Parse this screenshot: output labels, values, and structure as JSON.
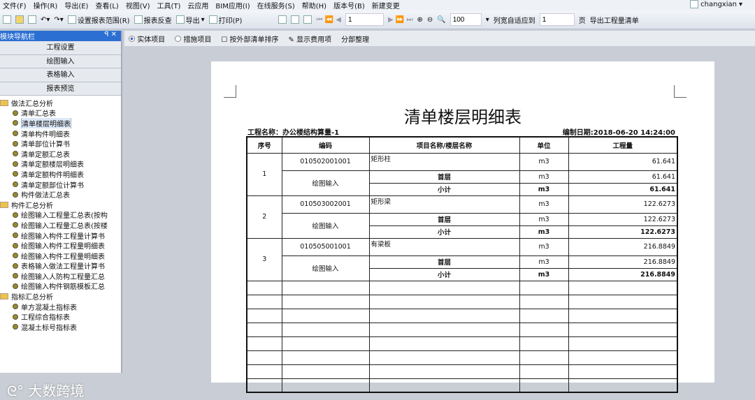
{
  "menu": [
    "文件(F)",
    "操作(R)",
    "导出(E)",
    "查看(L)",
    "视图(V)",
    "工具(T)",
    "云应用",
    "BIM应用(I)",
    "在线服务(S)",
    "帮助(H)",
    "版本号(B)",
    "新建变更"
  ],
  "user": "changxian",
  "toolbar": {
    "set_range": "设置报表范围(R)",
    "report_check": "报表反查",
    "export": "导出",
    "print": "打印(P)",
    "page": "1",
    "zoom": "100",
    "fit_label": "列宽自适应到",
    "fit_pages": "1",
    "page_unit": "页",
    "export_list": "导出工程量清单"
  },
  "nav": {
    "title": "模块导航栏",
    "buttons": [
      "工程设置",
      "绘图输入",
      "表格输入",
      "报表预览"
    ],
    "groups": [
      {
        "label": "做法汇总分析",
        "items": [
          "清单汇总表",
          "清单楼层明细表",
          "清单构件明细表",
          "清单部位计算书",
          "清单定额汇总表",
          "清单定额楼层明细表",
          "清单定额构件明细表",
          "清单定额部位计算书",
          "构件做法汇总表"
        ]
      },
      {
        "label": "构件汇总分析",
        "items": [
          "绘图输入工程量汇总表(按构",
          "绘图输入工程量汇总表(按楼",
          "绘图输入构件工程量计算书",
          "绘图输入构件工程量明细表",
          "绘图输入构件工程量明细表",
          "表格输入做法工程量计算书",
          "绘图输入人防构工程量汇总",
          "绘图输入构件钢筋模板汇总"
        ]
      },
      {
        "label": "指标汇总分析",
        "items": [
          "单方混凝土指标表",
          "工程综合指标表",
          "混凝土标号指标表"
        ]
      }
    ]
  },
  "subbar": {
    "radio1": "实体项目",
    "radio2": "措施项目",
    "sort": "按外部清单排序",
    "show_fee": "显示费用项",
    "section": "分部整理"
  },
  "report": {
    "title": "清单楼层明细表",
    "project": "工程名称：办公楼结构算量-1",
    "date": "编制日期:2018-06-20 14:24:00",
    "headers": [
      "序号",
      "编码",
      "项目名称/楼层名称",
      "单位",
      "工程量"
    ],
    "groups": [
      {
        "no": "1",
        "code": "010502001001",
        "name": "矩形柱",
        "unit": "m3",
        "qty": "61.641",
        "src": "绘图输入",
        "floor": "首层",
        "floor_qty": "61.641",
        "subtotal_label": "小计",
        "subtotal": "61.641"
      },
      {
        "no": "2",
        "code": "010503002001",
        "name": "矩形梁",
        "unit": "m3",
        "qty": "122.6273",
        "src": "绘图输入",
        "floor": "首层",
        "floor_qty": "122.6273",
        "subtotal_label": "小计",
        "subtotal": "122.6273"
      },
      {
        "no": "3",
        "code": "010505001001",
        "name": "有梁板",
        "unit": "m3",
        "qty": "216.8849",
        "src": "绘图输入",
        "floor": "首层",
        "floor_qty": "216.8849",
        "subtotal_label": "小计",
        "subtotal": "216.8849"
      }
    ]
  },
  "watermark": "大数跨境"
}
